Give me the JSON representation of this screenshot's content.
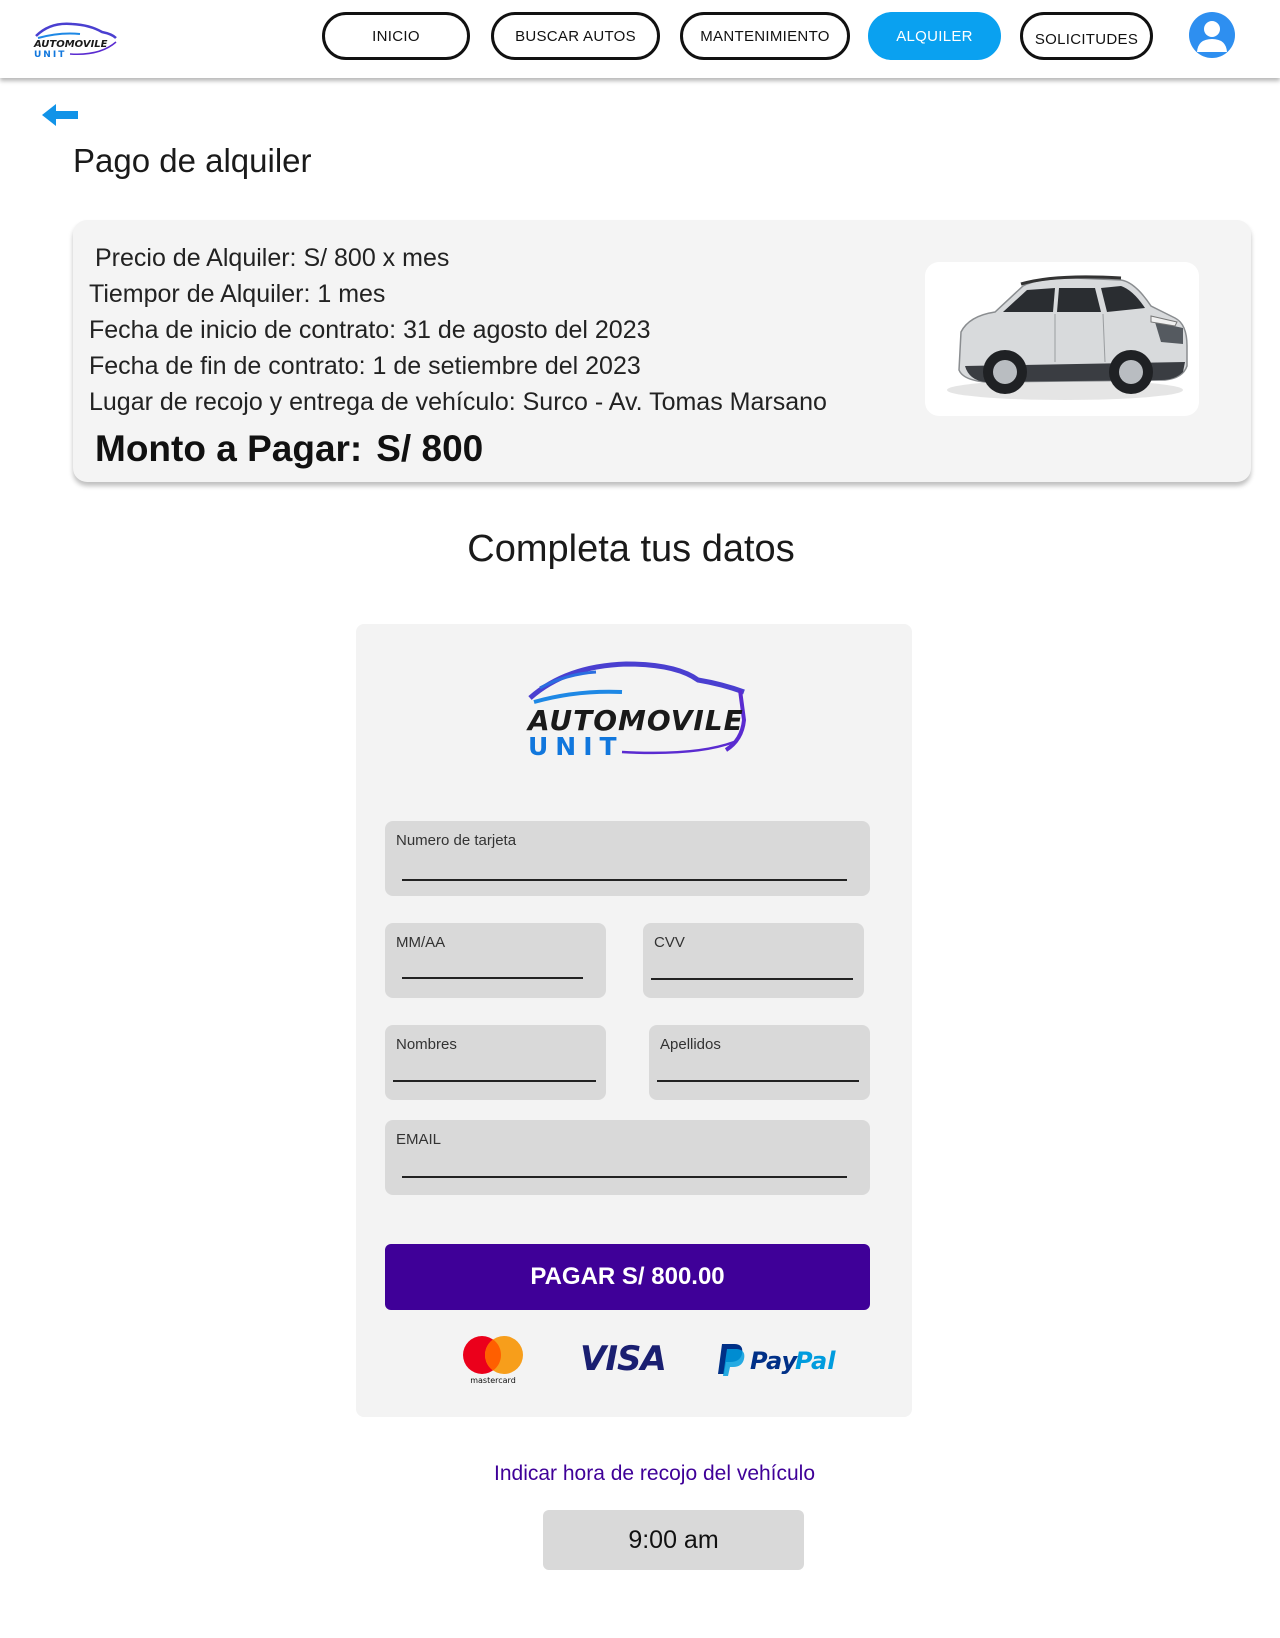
{
  "brand": {
    "line1": "AUTOMOVILE",
    "line2": "UNIT",
    "color_dark": "#1a1a1a",
    "color_blue": "#1177dd",
    "color_purple": "#5a2bd0"
  },
  "nav": {
    "items": [
      {
        "label": "INICIO",
        "active": false
      },
      {
        "label": "BUSCAR AUTOS",
        "active": false
      },
      {
        "label": "MANTENIMIENTO",
        "active": false
      },
      {
        "label": "ALQUILER",
        "active": true
      },
      {
        "label": "SOLICITUDES",
        "active": false
      }
    ],
    "active_color": "#0aa1f0",
    "avatar_icon": "user-avatar-icon"
  },
  "page": {
    "back_icon": "arrow-left-icon",
    "title": "Pago de alquiler"
  },
  "summary": {
    "lines": [
      "Precio de Alquiler:  S/ 800 x mes",
      "Tiempor de Alquiler: 1 mes",
      "Fecha de inicio de contrato: 31 de agosto del 2023",
      "Fecha de fin de contrato: 1 de setiembre del 2023",
      "Lugar de recojo y entrega de vehículo: Surco - Av. Tomas Marsano"
    ],
    "total_label": "Monto a Pagar:",
    "total_value": "S/ 800",
    "car_image": "white-suv-image"
  },
  "form": {
    "section_title": "Completa tus datos",
    "fields": {
      "card_number": {
        "label": "Numero de tarjeta",
        "value": ""
      },
      "expiry": {
        "label": "MM/AA",
        "value": ""
      },
      "cvv": {
        "label": "CVV",
        "value": ""
      },
      "first_name": {
        "label": "Nombres",
        "value": ""
      },
      "last_name": {
        "label": "Apellidos",
        "value": ""
      },
      "email": {
        "label": "EMAIL",
        "value": ""
      }
    },
    "pay_button": "PAGAR S/ 800.00",
    "pay_color": "#3f0098",
    "payment_methods": {
      "mastercard": "mastercard",
      "visa": "VISA",
      "paypal_a": "Pay",
      "paypal_b": "Pal"
    }
  },
  "pickup": {
    "link": "Indicar hora de recojo del vehículo",
    "time": "9:00 am"
  }
}
